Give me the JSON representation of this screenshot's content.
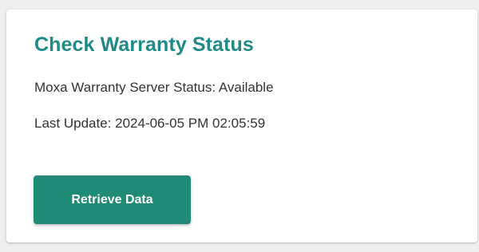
{
  "card": {
    "title": "Check Warranty Status",
    "server_status": "Moxa Warranty Server Status: Available",
    "last_update": "Last Update: 2024-06-05 PM 02:05:59",
    "retrieve_button_label": "Retrieve Data"
  },
  "colors": {
    "title_accent": "#1f8a87",
    "button_background": "#1f8a76",
    "page_background": "#eeeeee",
    "card_background": "#ffffff"
  }
}
